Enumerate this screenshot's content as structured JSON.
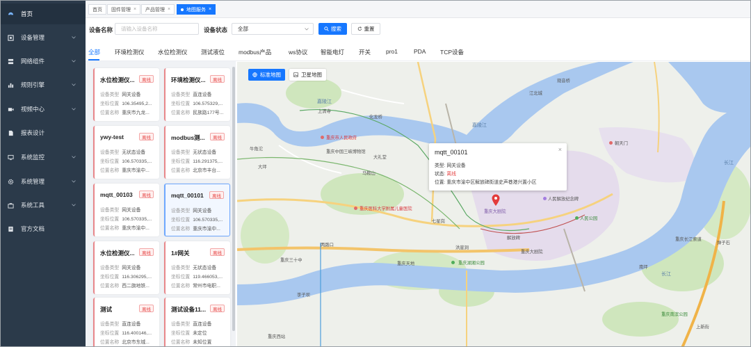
{
  "sidebar": {
    "items": [
      {
        "label": "首页",
        "icon": "dashboard-icon"
      },
      {
        "label": "设备管理",
        "icon": "device-icon"
      },
      {
        "label": "网络组件",
        "icon": "network-icon"
      },
      {
        "label": "规则引擎",
        "icon": "rule-engine-icon"
      },
      {
        "label": "视频中心",
        "icon": "video-icon"
      },
      {
        "label": "报表设计",
        "icon": "report-icon"
      },
      {
        "label": "系统监控",
        "icon": "monitor-icon"
      },
      {
        "label": "系统管理",
        "icon": "gear-icon"
      },
      {
        "label": "系统工具",
        "icon": "toolbox-icon"
      },
      {
        "label": "官方文档",
        "icon": "document-icon"
      }
    ]
  },
  "top_tabs": [
    {
      "label": "首页"
    },
    {
      "label": "固件管理",
      "close": "×"
    },
    {
      "label": "产品管理",
      "close": "×"
    },
    {
      "label": "地图服务",
      "close": "×"
    }
  ],
  "filters": {
    "device_name_label": "设备名称",
    "device_name_placeholder": "请输入设备名称",
    "device_status_label": "设备状态",
    "device_status_value": "全部",
    "search_label": "搜索",
    "reset_label": "重置"
  },
  "category_tabs": [
    "全部",
    "环境检测仪",
    "水位检测仪",
    "测试液位",
    "modbus产品",
    "ws协议",
    "智能电灯",
    "开关",
    "pro1",
    "PDA",
    "TCP设备"
  ],
  "field_labels": {
    "type": "设备类型",
    "coord": "坐标位置",
    "location": "位置名称"
  },
  "cards": [
    {
      "name": "水位检测仪...",
      "status": "离线",
      "type": "网关设备",
      "coord": "106.35495,2...",
      "location": "重庆市九龙..."
    },
    {
      "name": "环境检测仪...",
      "status": "离线",
      "type": "直连设备",
      "coord": "106.575329,...",
      "location": "民族路177号..."
    },
    {
      "name": "ywy-test",
      "status": "离线",
      "type": "无状态设备",
      "coord": "106.570335,...",
      "location": "重庆市渝中..."
    },
    {
      "name": "modbus测...",
      "status": "离线",
      "type": "无状态设备",
      "coord": "116.291375,...",
      "location": "北京市丰台..."
    },
    {
      "name": "mqtt_00103",
      "status": "离线",
      "type": "网关设备",
      "coord": "106.570335,...",
      "location": "重庆市渝中..."
    },
    {
      "name": "mqtt_00101",
      "status": "离线",
      "type": "网关设备",
      "coord": "106.570335,...",
      "location": "重庆市渝中..."
    },
    {
      "name": "水位检测仪...",
      "status": "离线",
      "type": "网关设备",
      "coord": "116.306295,...",
      "location": "西二旗地铁..."
    },
    {
      "name": "1#网关",
      "status": "离线",
      "type": "无状态设备",
      "coord": "119.466053,...",
      "location": "常州市电职..."
    },
    {
      "name": "测试",
      "status": "离线",
      "type": "直连设备",
      "coord": "116.400146,...",
      "location": "北京市东城..."
    },
    {
      "name": "测试设备11...",
      "status": "离线",
      "type": "直连设备",
      "coord": "未定位",
      "location": "未知位置"
    }
  ],
  "map": {
    "standard_label": "标准地图",
    "satellite_label": "卫星地图",
    "popup": {
      "title": "mqtt_00101",
      "close": "×",
      "type_label": "类型:",
      "type_value": "网关设备",
      "status_label": "状态:",
      "status_value": "离线",
      "location_label": "位置:",
      "location_value": "重庆市渝中区解放碑街道史声巷港兴置小区"
    },
    "place_labels": [
      "嘉陵江",
      "嘉陵江",
      "长江",
      "长江",
      "重庆市人民政府",
      "重庆中国三峡博物馆",
      "大礼堂",
      "马鞍山",
      "重庆医科大学附属儿童医院",
      "大坪",
      "两路口",
      "重庆三十中",
      "七星岗",
      "重庆大剧院",
      "解放碑",
      "朝天门",
      "人民解放纪念碑",
      "人民公园",
      "重庆南滨公园",
      "重庆长江索道",
      "重庆天地",
      "李子坝",
      "重庆湖湘公园",
      "洪崖洞",
      "上新街",
      "南坪",
      "弹子石",
      "江北城",
      "重庆西站",
      "化龙桥",
      "牛角沱",
      "上清寺",
      "重庆大剧院",
      "观音桥"
    ]
  },
  "colors": {
    "accent": "#1677ff",
    "sidebar_bg": "#2b3a4a",
    "offline": "#e54545",
    "river": "#a9c8ef",
    "green_space": "#c7e3b2"
  }
}
